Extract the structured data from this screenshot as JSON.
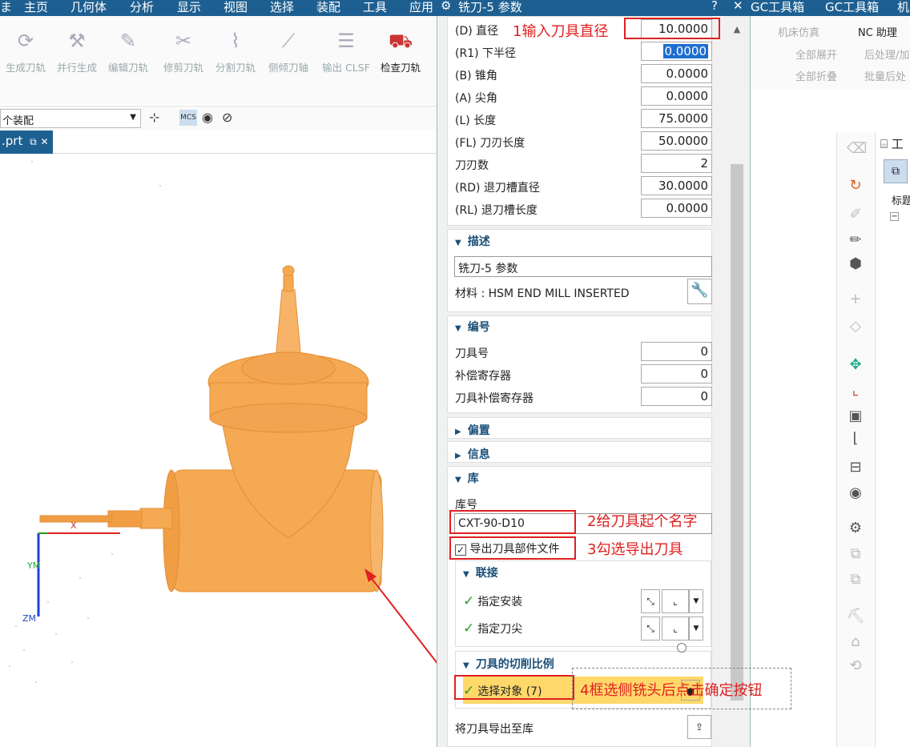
{
  "menubar": {
    "items": [
      "主页",
      "几何体",
      "分析",
      "显示",
      "视图",
      "选择",
      "装配",
      "工具",
      "应用"
    ],
    "right_items": [
      "GC工具箱",
      "GC工具箱",
      "机"
    ]
  },
  "ribbon": {
    "buttons": [
      {
        "label": "生成刀轨",
        "icon": "generate-toolpath-icon"
      },
      {
        "label": "并行生成",
        "icon": "parallel-generate-icon"
      },
      {
        "label": "编辑刀轨",
        "icon": "edit-toolpath-icon"
      },
      {
        "label": "修剪刀轨",
        "icon": "trim-toolpath-icon"
      },
      {
        "label": "分割刀轨",
        "icon": "split-toolpath-icon"
      },
      {
        "label": "侧倾刀轴",
        "icon": "tilt-tool-axis-icon"
      },
      {
        "label": "输出 CLSF",
        "icon": "output-clsf-icon"
      },
      {
        "label": "检查刀轨",
        "icon": "check-toolpath-icon"
      }
    ],
    "assembly_select": "个装配",
    "right_items": [
      "机床仿真",
      "NC 助理",
      "全部展开",
      "后处理/加",
      "全部折叠",
      "批量后处"
    ]
  },
  "tab": {
    "label": ".prt"
  },
  "nav": {
    "label": "工",
    "col_header": "标题"
  },
  "dialog": {
    "title": "铣刀-5 参数",
    "params": [
      {
        "label": "(D) 直径",
        "value": "10.0000"
      },
      {
        "label": "(R1) 下半径",
        "value": "0.0000"
      },
      {
        "label": "(B) 锥角",
        "value": "0.0000"
      },
      {
        "label": "(A) 尖角",
        "value": "0.0000"
      },
      {
        "label": "(L) 长度",
        "value": "75.0000"
      },
      {
        "label": "(FL) 刀刃长度",
        "value": "50.0000"
      },
      {
        "label": "刀刃数",
        "value": "2"
      },
      {
        "label": "(RD) 退刀槽直径",
        "value": "30.0000"
      },
      {
        "label": "(RL) 退刀槽长度",
        "value": "0.0000"
      }
    ],
    "description": {
      "header": "描述",
      "text": "铣刀-5 参数",
      "material": "材料 : HSM END MILL INSERTED"
    },
    "numbering": {
      "header": "编号",
      "rows": [
        {
          "label": "刀具号",
          "value": "0"
        },
        {
          "label": "补偿寄存器",
          "value": "0"
        },
        {
          "label": "刀具补偿寄存器",
          "value": "0"
        }
      ]
    },
    "offset_header": "偏置",
    "info_header": "信息",
    "library": {
      "header": "库",
      "lib_label": "库号",
      "lib_value": "CXT-90-D10",
      "export_checkbox": "导出刀具部件文件",
      "export_checked": true,
      "link_header": "联接",
      "specify_mount": "指定安装",
      "specify_tip": "指定刀尖"
    },
    "cutting": {
      "header": "刀具的切削比例",
      "select_object": "选择对象 (7)"
    },
    "export_to_library": "将刀具导出至库"
  },
  "annotations": {
    "a1": "1输入刀具直径",
    "a2": "2给刀具起个名字",
    "a3": "3勾选导出刀具",
    "a4": "4框选侧铣头后点击确定按钮"
  },
  "viewport": {
    "axis_x": "X",
    "axis_y": "YM",
    "axis_z": "ZM",
    "model_color": "#f5a54a"
  }
}
